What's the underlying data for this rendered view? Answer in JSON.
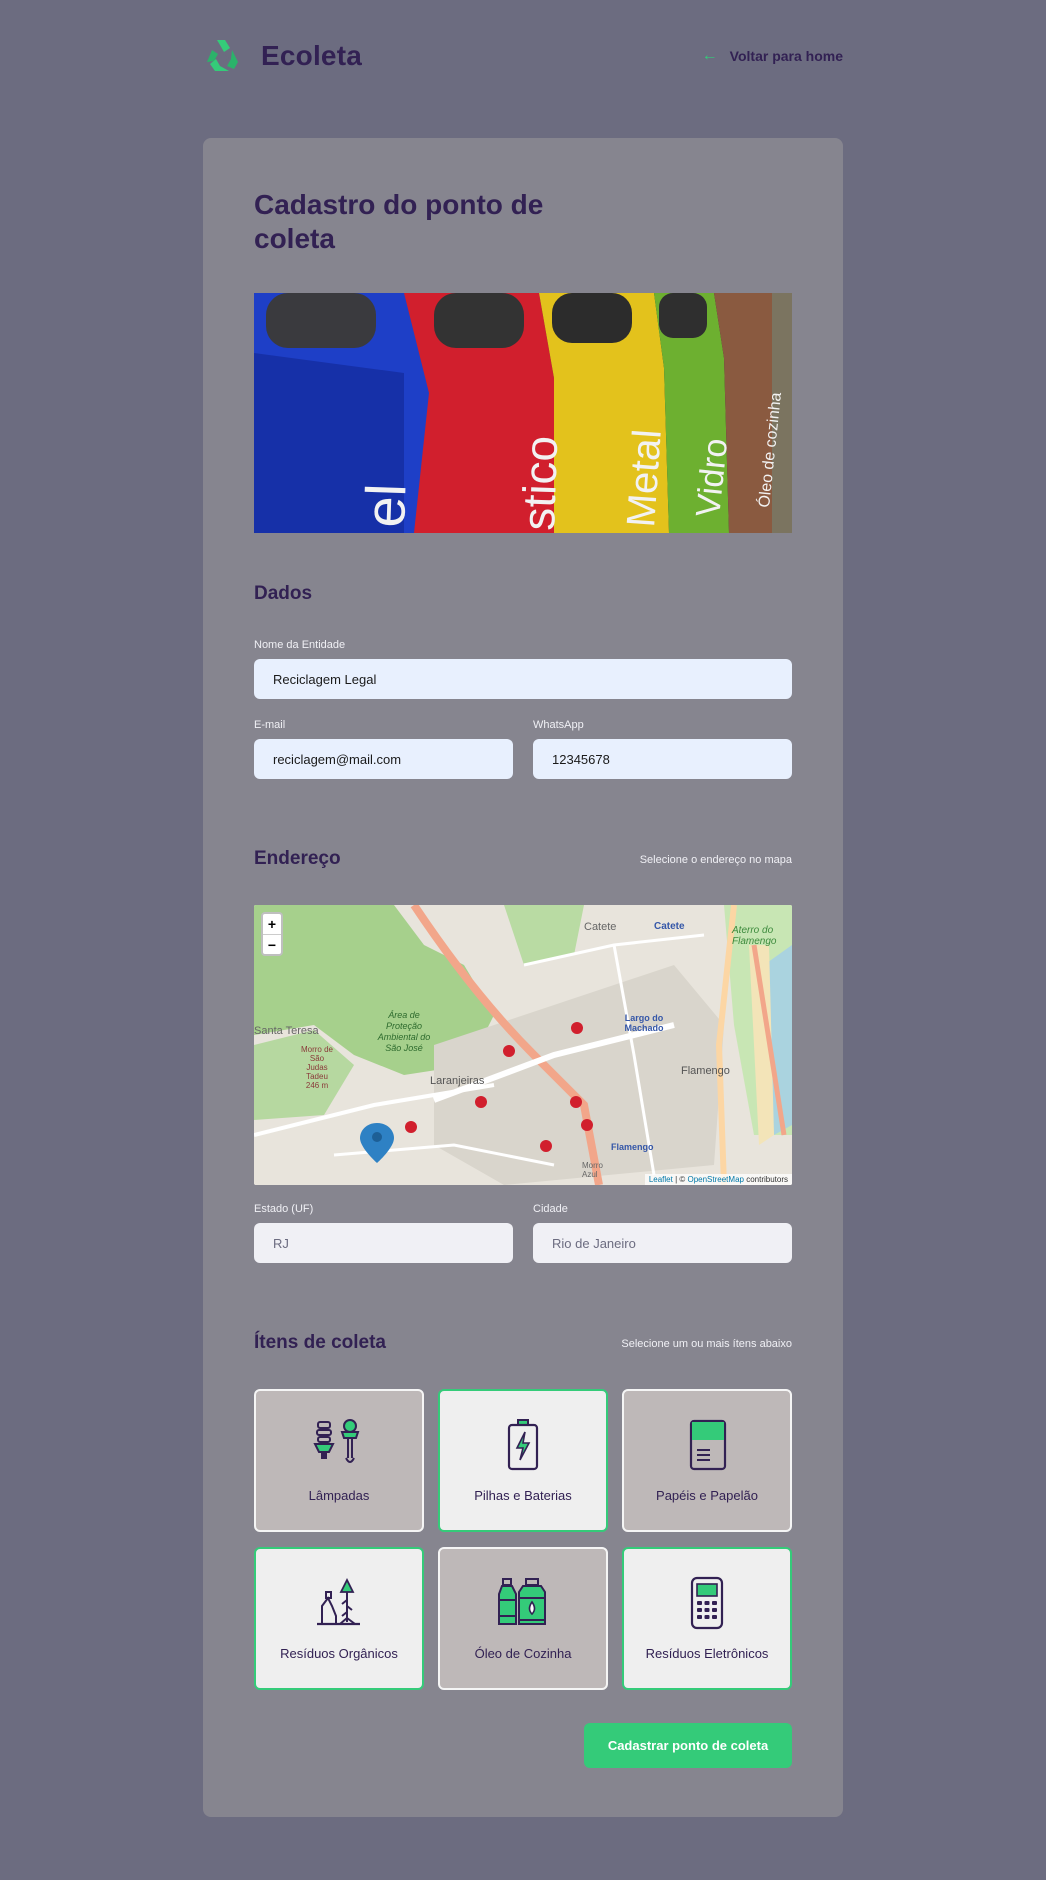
{
  "header": {
    "logo_text": "Ecoleta",
    "back_arrow": "←",
    "back_label": "Voltar para home"
  },
  "form": {
    "title": "Cadastro do ponto de coleta",
    "dados": {
      "section_title": "Dados",
      "name_label": "Nome da Entidade",
      "name_value": "Reciclagem Legal",
      "email_label": "E-mail",
      "email_value": "reciclagem@mail.com",
      "whatsapp_label": "WhatsApp",
      "whatsapp_value": "12345678"
    },
    "endereco": {
      "section_title": "Endereço",
      "hint": "Selecione o endereço no mapa",
      "zoom_in": "+",
      "zoom_out": "−",
      "attribution_leaflet": "Leaflet",
      "attribution_sep": " | © ",
      "attribution_osm": "OpenStreetMap",
      "attribution_tail": " contributors",
      "map_labels": {
        "catete": "Catete",
        "catete2": "Catete",
        "aterro": "Aterro do Flamengo",
        "santa_teresa": "Santa Teresa",
        "area": "Área de Proteção Ambiental do São José",
        "largo": "Largo do Machado",
        "flamengo": "Flamengo",
        "flamengo2": "Flamengo",
        "laranjeiras": "Laranjeiras",
        "morro": "Morro Azul",
        "morro_dos": "Morro de São Judas Tadeu 246 m"
      },
      "uf_label": "Estado (UF)",
      "uf_value": "RJ",
      "city_label": "Cidade",
      "city_value": "Rio de Janeiro"
    },
    "itens": {
      "section_title": "Ítens de coleta",
      "hint": "Selecione um ou mais ítens abaixo",
      "list": [
        {
          "label": "Lâmpadas",
          "icon": "lamps-icon",
          "selected": false
        },
        {
          "label": "Pilhas e Baterias",
          "icon": "battery-icon",
          "selected": true
        },
        {
          "label": "Papéis e Papelão",
          "icon": "paper-icon",
          "selected": false
        },
        {
          "label": "Resíduos Orgânicos",
          "icon": "organic-icon",
          "selected": true
        },
        {
          "label": "Óleo de Cozinha",
          "icon": "oil-icon",
          "selected": false
        },
        {
          "label": "Resíduos Eletrônicos",
          "icon": "electronic-icon",
          "selected": true
        }
      ]
    },
    "submit_label": "Cadastrar ponto de coleta"
  },
  "colors": {
    "accent": "#34cb79",
    "title": "#322153",
    "background": "#6c6c80"
  }
}
